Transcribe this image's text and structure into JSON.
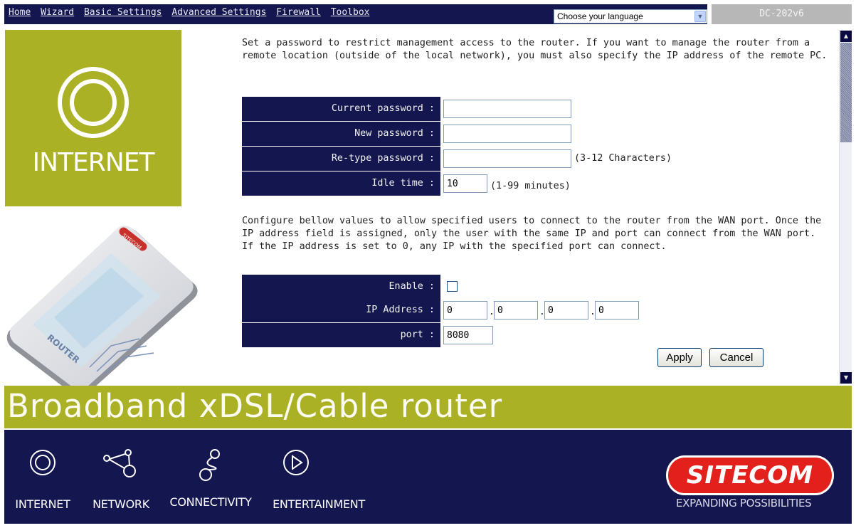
{
  "nav": {
    "items": [
      "Home",
      "Wizard",
      "Basic Settings",
      "Advanced Settings",
      "Firewall",
      "Toolbox"
    ],
    "language_select": "Choose your language",
    "model": "DC-202v6"
  },
  "left": {
    "internet_label": "INTERNET",
    "device_brand": "SITECOM",
    "device_label": "ROUTER"
  },
  "intro_text": "Set a password to restrict management access to the router. If you want to manage the router from a remote location (outside of the local network), you must also specify the IP address of the remote PC.",
  "password_form": {
    "current_label": "Current password :",
    "current_value": "",
    "new_label": "New password :",
    "new_value": "",
    "retype_label": "Re-type password :",
    "retype_value": "",
    "retype_hint": "(3-12 Characters)",
    "idle_label": "Idle time :",
    "idle_value": "10",
    "idle_hint": "(1-99 minutes)"
  },
  "wan_text": "Configure bellow values to allow specified users to connect to the router from the WAN port. Once the IP address field is assigned, only the user with the same IP and port can connect from the WAN port. If the IP address is set to 0, any IP with the specified port can connect.",
  "wan_form": {
    "enable_label": "Enable :",
    "enable_checked": false,
    "ip_label": "IP Address :",
    "ip_octets": [
      "0",
      "0",
      "0",
      "0"
    ],
    "port_label": "port :",
    "port_value": "8080"
  },
  "buttons": {
    "apply": "Apply",
    "cancel": "Cancel"
  },
  "banner": "Broadband xDSL/Cable router",
  "footer": {
    "icons": [
      {
        "label": "INTERNET",
        "icon": "internet-icon"
      },
      {
        "label": "NETWORK",
        "icon": "network-icon"
      },
      {
        "label": "CONNECTIVITY",
        "icon": "connectivity-icon"
      },
      {
        "label": "ENTERTAINMENT",
        "icon": "entertainment-icon"
      }
    ],
    "logo": "SITECOM",
    "tagline": "EXPANDING POSSIBILITIES"
  },
  "colors": {
    "navy": "#13164f",
    "olive": "#abb124",
    "sitecom_red": "#e3201b"
  }
}
